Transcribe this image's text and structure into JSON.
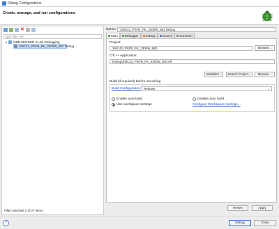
{
  "window": {
    "title": "Debug Configurations"
  },
  "header": {
    "title": "Create, manage, and run configurations"
  },
  "left": {
    "filter_placeholder": "type filter text",
    "tree": {
      "group": "GDB SEGGER J-Link Debugging",
      "item": "XMC42_PSFB_PK_3300W_BID Debug"
    },
    "status": "Filter matched 2 of 27 items"
  },
  "right": {
    "name_label": "Name:",
    "name_value": "XMC42_PSFB_PK_3300W_BID Debug",
    "tabs": [
      {
        "label": "Main",
        "icon": "main-icon"
      },
      {
        "label": "Debugger",
        "icon": "debugger-icon"
      },
      {
        "label": "Startup",
        "icon": "startup-icon"
      },
      {
        "label": "Source",
        "icon": "source-icon"
      },
      {
        "label": "Common",
        "icon": "common-icon"
      }
    ],
    "project_label": "Project:",
    "project_value": "XMC42_PSFB_PK_3300W_BID",
    "browse": "Browse...",
    "app_label": "C/C++ Application:",
    "app_value": "Debug\\XMC42_PSFB_PK_3300W_BID.elf",
    "variables": "Variables...",
    "search_project": "Search Project...",
    "build_label": "Build (if required) before launching",
    "build_config_link": "Build Configuration:",
    "build_config_value": "Release",
    "enable_auto": "Enable auto build",
    "disable_auto": "Disable auto build",
    "use_workspace": "Use workspace settings",
    "configure_link": "Configure Workspace Settings...",
    "revert": "Revert",
    "apply": "Apply"
  },
  "bottom": {
    "help": "?",
    "debug": "Debug",
    "close": "Close"
  }
}
